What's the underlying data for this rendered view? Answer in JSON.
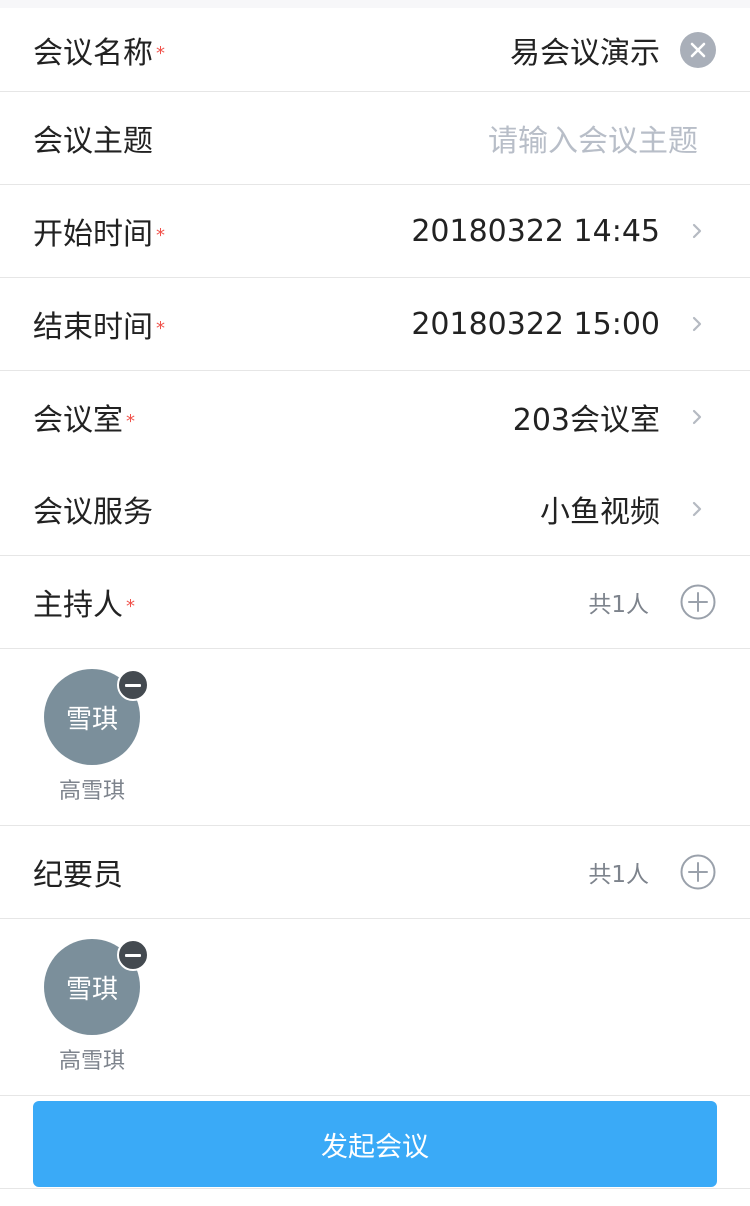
{
  "form": {
    "meeting_name": {
      "label": "会议名称",
      "required": true,
      "value": "易会议演示"
    },
    "meeting_topic": {
      "label": "会议主题",
      "required": false,
      "placeholder": "请输入会议主题"
    },
    "start_time": {
      "label": "开始时间",
      "required": true,
      "value": "20180322 14:45"
    },
    "end_time": {
      "label": "结束时间",
      "required": true,
      "value": "20180322 15:00"
    },
    "meeting_room": {
      "label": "会议室",
      "required": true,
      "value": "203会议室"
    },
    "meeting_service": {
      "label": "会议服务",
      "required": false,
      "value": "小鱼视频"
    },
    "required_mark": "*"
  },
  "host": {
    "label": "主持人",
    "required": true,
    "count": "共1人",
    "people": [
      {
        "avatar_text": "雪琪",
        "name": "高雪琪"
      }
    ]
  },
  "recorder": {
    "label": "纪要员",
    "required": false,
    "count": "共1人",
    "people": [
      {
        "avatar_text": "雪琪",
        "name": "高雪琪"
      }
    ]
  },
  "submit_label": "发起会议",
  "colors": {
    "accent": "#3aaaf7",
    "required": "#f0514a",
    "avatar": "#7b8f9b",
    "placeholder": "#b8bec8"
  },
  "icons": {
    "clear": "clear-icon",
    "chevron": "chevron-right-icon",
    "add": "plus-circle-icon",
    "remove": "minus-circle-icon"
  }
}
